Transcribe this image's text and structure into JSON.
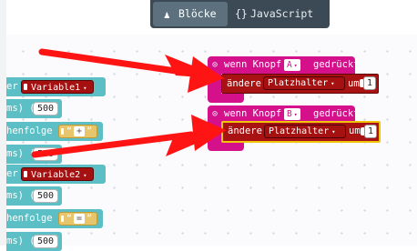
{
  "tabs": {
    "blocks": {
      "icon": "puzzle-piece-icon",
      "icon_glyph": "♟",
      "label": "Blöcke"
    },
    "javascript": {
      "icon": "braces-icon",
      "icon_glyph": "{}",
      "label": "JavaScript"
    }
  },
  "flyout": [
    {
      "prefix": "er",
      "variable": "Variable1"
    },
    {
      "prefix": "ms) (",
      "number": "500"
    },
    {
      "prefix": "henfolge (",
      "string_op": "+"
    },
    {
      "prefix": "ms) (",
      "number": "500"
    },
    {
      "prefix": "er",
      "variable": "Variable2"
    },
    {
      "prefix": "ms) (",
      "number": "500"
    },
    {
      "prefix": "henfolge (",
      "string_op": "="
    },
    {
      "prefix": "ms) (",
      "number": "500"
    }
  ],
  "events": [
    {
      "label": "wenn Knopf",
      "button": "A",
      "suffix": "gedrückt",
      "statement": {
        "label": "ändere",
        "variable": "Platzhalter",
        "by": "um",
        "value": "1"
      }
    },
    {
      "label": "wenn Knopf",
      "button": "B",
      "suffix": "gedrückt",
      "statement": {
        "label": "ändere",
        "variable": "Platzhalter",
        "by": "um",
        "value": "1"
      }
    }
  ],
  "colors": {
    "event": "#d4108a",
    "variable": "#a81212",
    "flyout": "#5cbfc5",
    "arrow": "#ff1414",
    "selection": "#f0c40b",
    "toolbar": "#3b4a55"
  },
  "dropdown_glyph": "▾",
  "gear_glyph": "⊙"
}
